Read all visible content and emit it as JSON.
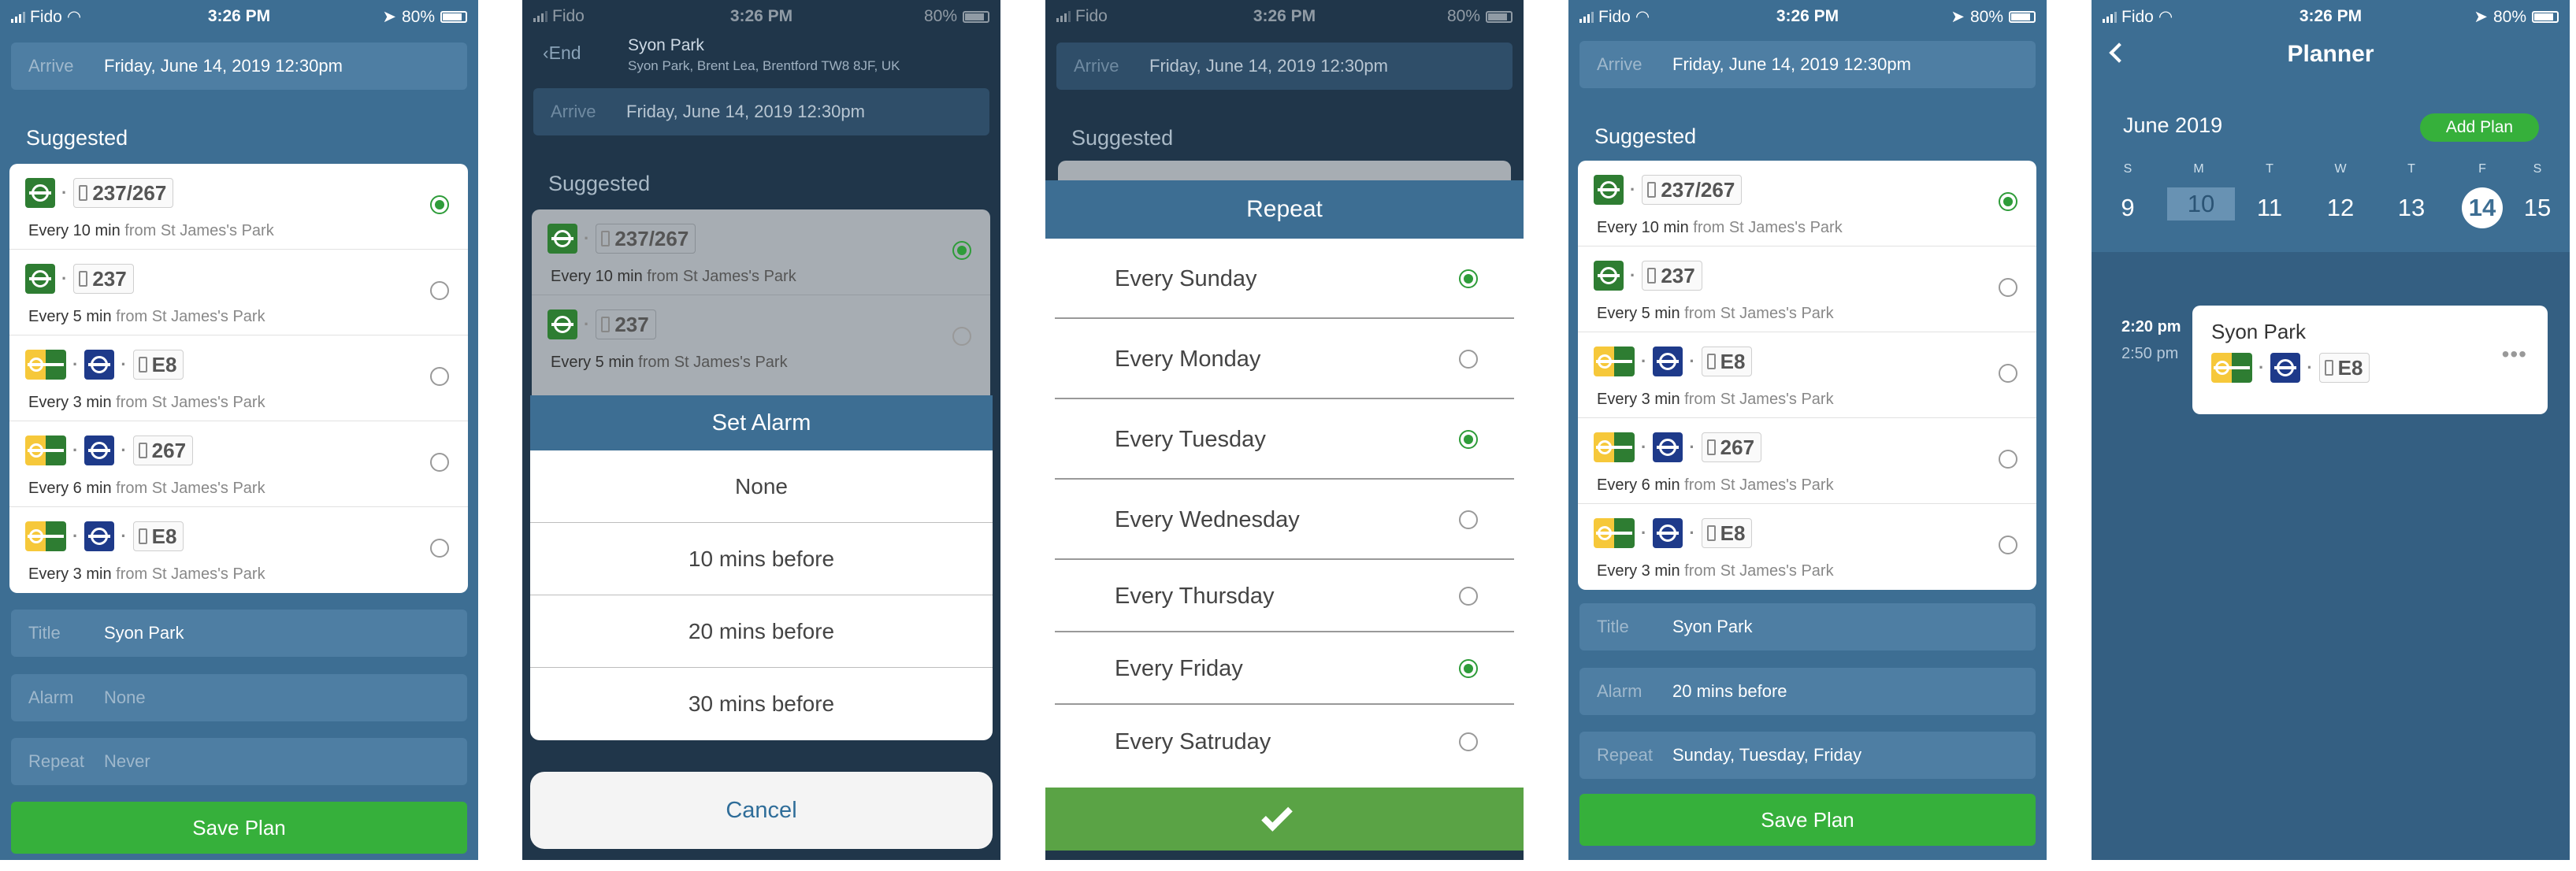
{
  "status": {
    "carrier": "Fido",
    "time": "3:26 PM",
    "battery": "80%"
  },
  "plan": {
    "arrive_label": "Arrive",
    "arrive_value": "Friday, June 14, 2019 12:30pm",
    "suggested_label": "Suggested",
    "title_label": "Title",
    "title_value": "Syon Park",
    "alarm_label": "Alarm",
    "alarm_value_initial": "None",
    "alarm_value_set": "20 mins before",
    "repeat_label": "Repeat",
    "repeat_value_initial": "Never",
    "repeat_value_set": "Sunday, Tuesday, Friday",
    "save_label": "Save Plan",
    "end_label": "End",
    "end_place": "Syon Park",
    "end_address": "Syon Park, Brent Lea, Brentford TW8 8JF, UK"
  },
  "routes": [
    {
      "lines": [
        "tube-green"
      ],
      "bus": "237/267",
      "every": "Every 10 min",
      "from": "from St James's Park",
      "selected": true
    },
    {
      "lines": [
        "tube-green"
      ],
      "bus": "237",
      "every": "Every 5 min",
      "from": "from St James's Park",
      "selected": false
    },
    {
      "lines": [
        "tube-yellow-green",
        "tube-blue"
      ],
      "bus": "E8",
      "every": "Every 3 min",
      "from": "from St James's Park",
      "selected": false
    },
    {
      "lines": [
        "tube-yellow-green",
        "tube-blue"
      ],
      "bus": "267",
      "every": "Every 6 min",
      "from": "from St James's Park",
      "selected": false
    },
    {
      "lines": [
        "tube-yellow-green",
        "tube-blue"
      ],
      "bus": "E8",
      "every": "Every 3 min",
      "from": "from St James's Park",
      "selected": false
    }
  ],
  "alarm_sheet": {
    "title": "Set Alarm",
    "options": [
      "None",
      "10 mins before",
      "20 mins before",
      "30 mins before"
    ],
    "cancel": "Cancel"
  },
  "repeat_sheet": {
    "title": "Repeat",
    "options": [
      {
        "label": "Every Sunday",
        "on": true
      },
      {
        "label": "Every Monday",
        "on": false
      },
      {
        "label": "Every Tuesday",
        "on": true
      },
      {
        "label": "Every Wednesday",
        "on": false
      },
      {
        "label": "Every Thursday",
        "on": false
      },
      {
        "label": "Every Friday",
        "on": true
      },
      {
        "label": "Every Satruday",
        "on": false
      }
    ]
  },
  "planner": {
    "title": "Planner",
    "month": "June 2019",
    "add_plan": "Add Plan",
    "days": [
      {
        "dow": "S",
        "num": "9"
      },
      {
        "dow": "M",
        "num": "10"
      },
      {
        "dow": "T",
        "num": "11"
      },
      {
        "dow": "W",
        "num": "12"
      },
      {
        "dow": "T",
        "num": "13"
      },
      {
        "dow": "F",
        "num": "14"
      },
      {
        "dow": "S",
        "num": "15"
      }
    ],
    "event": {
      "start": "2:20 pm",
      "end": "2:50 pm",
      "title": "Syon Park",
      "bus": "E8"
    }
  },
  "colors": {
    "primary": "#3d6e93",
    "green": "#36b03b",
    "tube_green": "#2e7d32",
    "tube_blue": "#1e3a8a",
    "tube_yellow": "#f6c83a"
  }
}
